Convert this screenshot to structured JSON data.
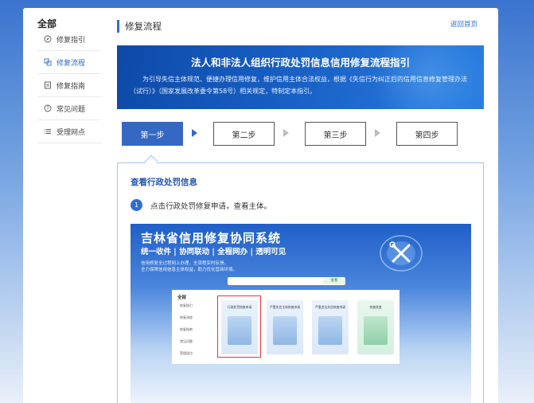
{
  "sidebar": {
    "title": "全部",
    "items": [
      {
        "label": "修复指引",
        "icon": "compass-icon",
        "active": false
      },
      {
        "label": "修复流程",
        "icon": "flow-icon",
        "active": true
      },
      {
        "label": "修复指南",
        "icon": "guide-icon",
        "active": false
      },
      {
        "label": "常见问题",
        "icon": "question-icon",
        "active": false
      },
      {
        "label": "受理网点",
        "icon": "list-icon",
        "active": false
      }
    ]
  },
  "header": {
    "title": "修复流程",
    "back_label": "返回首页"
  },
  "banner": {
    "title": "法人和非法人组织行政处罚信息信用修复流程指引",
    "description": "为引导失信主体规范、便捷办理信用修复，维护信用主体合法权益，根据《失信行为纠正后的信用信息修复管理办法（试行）》（国家发展改革委令第58号）相关规定，特制定本指引。"
  },
  "steps": [
    {
      "label": "第一步",
      "active": true
    },
    {
      "label": "第二步",
      "active": false
    },
    {
      "label": "第三步",
      "active": false
    },
    {
      "label": "第四步",
      "active": false
    }
  ],
  "content": {
    "section_title": "查看行政处罚信息",
    "step_number": "1",
    "step_text": "点击行政处罚修复申请，查看主体。"
  },
  "screenshot": {
    "title": "吉林省信用修复协同系统",
    "subtitle": "统一收件 | 协同联动 | 全程网办 | 透明可见",
    "lines": [
      "信用修复全过程网上办理，全流程实时反馈。",
      "全力保障信用信息主体权益，助力优化营商环境。"
    ],
    "search_button": "查看",
    "panel_title": "全部",
    "menu": [
      "修复指引",
      "修复流程",
      "修复指南",
      "常见问题",
      "受理网点"
    ],
    "tiles": [
      "行政处罚修复申请",
      "严重失信主体修复申请",
      "严重违法失信修复申请",
      "修复进度"
    ]
  },
  "colors": {
    "accent": "#2f6ed0",
    "banner": "#1a63c9",
    "active_step": "#3468c3",
    "highlight": "#e03a30"
  }
}
